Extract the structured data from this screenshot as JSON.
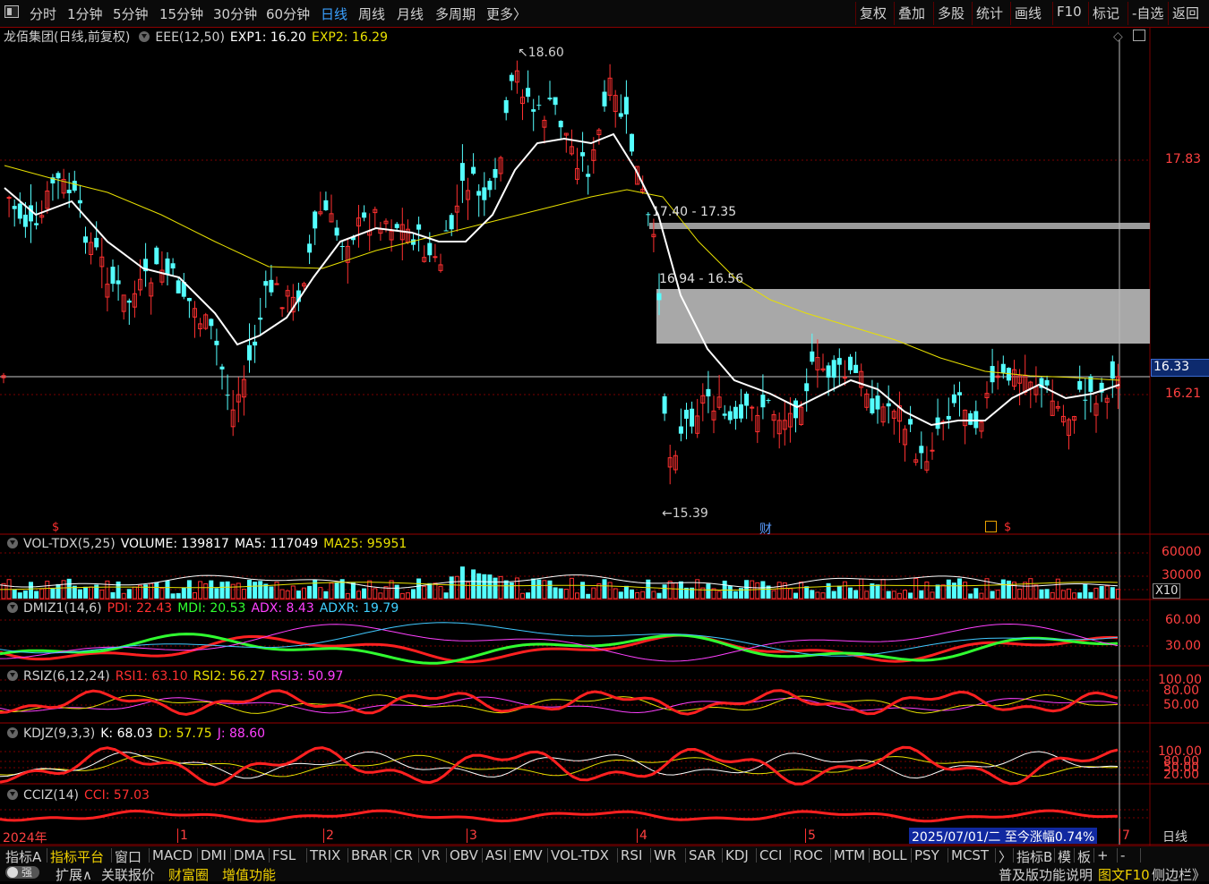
{
  "toolbar": {
    "periods": [
      "分时",
      "1分钟",
      "5分钟",
      "15分钟",
      "30分钟",
      "60分钟",
      "日线",
      "周线",
      "月线",
      "多周期",
      "更多〉"
    ],
    "active_period": "日线",
    "right_buttons": [
      "复权",
      "叠加",
      "多股",
      "统计",
      "画线",
      "F10",
      "标记",
      "-自选",
      "返回"
    ]
  },
  "main_header": {
    "name": "龙佰集团(日线,前复权)",
    "indicator": "EEE(12,50)",
    "exp1": "EXP1: 16.20",
    "exp2": "EXP2: 16.29"
  },
  "price_labels": {
    "high": "18.60",
    "low": "15.39",
    "zone1": "17.40 - 17.35",
    "zone2": "16.94 - 16.56",
    "axis_1": "17.83",
    "axis_2": "16.21",
    "current": "16.33",
    "marker_cai": "财",
    "marker_s1": "$",
    "marker_s2": "$"
  },
  "vol_header": {
    "name": "VOL-TDX(5,25)",
    "volume": "VOLUME: 139817",
    "ma5": "MA5: 117049",
    "ma25": "MA25: 95951",
    "axis_1": "60000",
    "axis_2": "30000",
    "unit": "X10"
  },
  "dmi_header": {
    "name": "DMIZ1(14,6)",
    "pdi": "PDI: 22.43",
    "mdi": "MDI: 20.53",
    "adx": "ADX: 8.43",
    "adxr": "ADXR: 19.79",
    "axis_1": "60.00",
    "axis_2": "30.00"
  },
  "rsi_header": {
    "name": "RSIZ(6,12,24)",
    "rsi1": "RSI1: 63.10",
    "rsi2": "RSI2: 56.27",
    "rsi3": "RSI3: 50.97",
    "axis_1": "100.00",
    "axis_2": "80.00",
    "axis_3": "50.00"
  },
  "kdj_header": {
    "name": "KDJZ(9,3,3)",
    "k": "K: 68.03",
    "d": "D: 57.75",
    "j": "J: 88.60",
    "axis_1": "100.00",
    "axis_2": "80.00",
    "axis_3": "50.00",
    "axis_4": "20.00"
  },
  "cci_header": {
    "name": "CCIZ(14)",
    "cci": "CCI: 57.03"
  },
  "date_axis": {
    "year": "2024年",
    "months": [
      "1",
      "2",
      "3",
      "4",
      "5",
      "7"
    ],
    "info": "2025/07/01/二  至今涨幅0.74%",
    "period_btn": "日线"
  },
  "bottom_tabs": [
    "指标A",
    "指标平台",
    "窗口",
    "MACD",
    "DMI",
    "DMA",
    "FSL",
    "TRIX",
    "BRAR",
    "CR",
    "VR",
    "OBV",
    "ASI",
    "EMV",
    "VOL-TDX",
    "RSI",
    "WR",
    "SAR",
    "KDJ",
    "CCI",
    "ROC",
    "MTM",
    "BOLL",
    "PSY",
    "MCST",
    "〉",
    "指标B",
    "模",
    "板",
    "+",
    "-"
  ],
  "bottom2": {
    "toggle": "强",
    "items": [
      "扩展∧",
      "关联报价",
      "财富圈",
      "增值功能"
    ],
    "right": "普及版功能说明",
    "right2": "图文F10",
    "right3": "侧边栏》"
  },
  "colors": {
    "up": "#ff3030",
    "down": "#54ffff",
    "ema_short": "#ffffff",
    "ema_long": "#e8e000",
    "grid": "#7a0000"
  }
}
